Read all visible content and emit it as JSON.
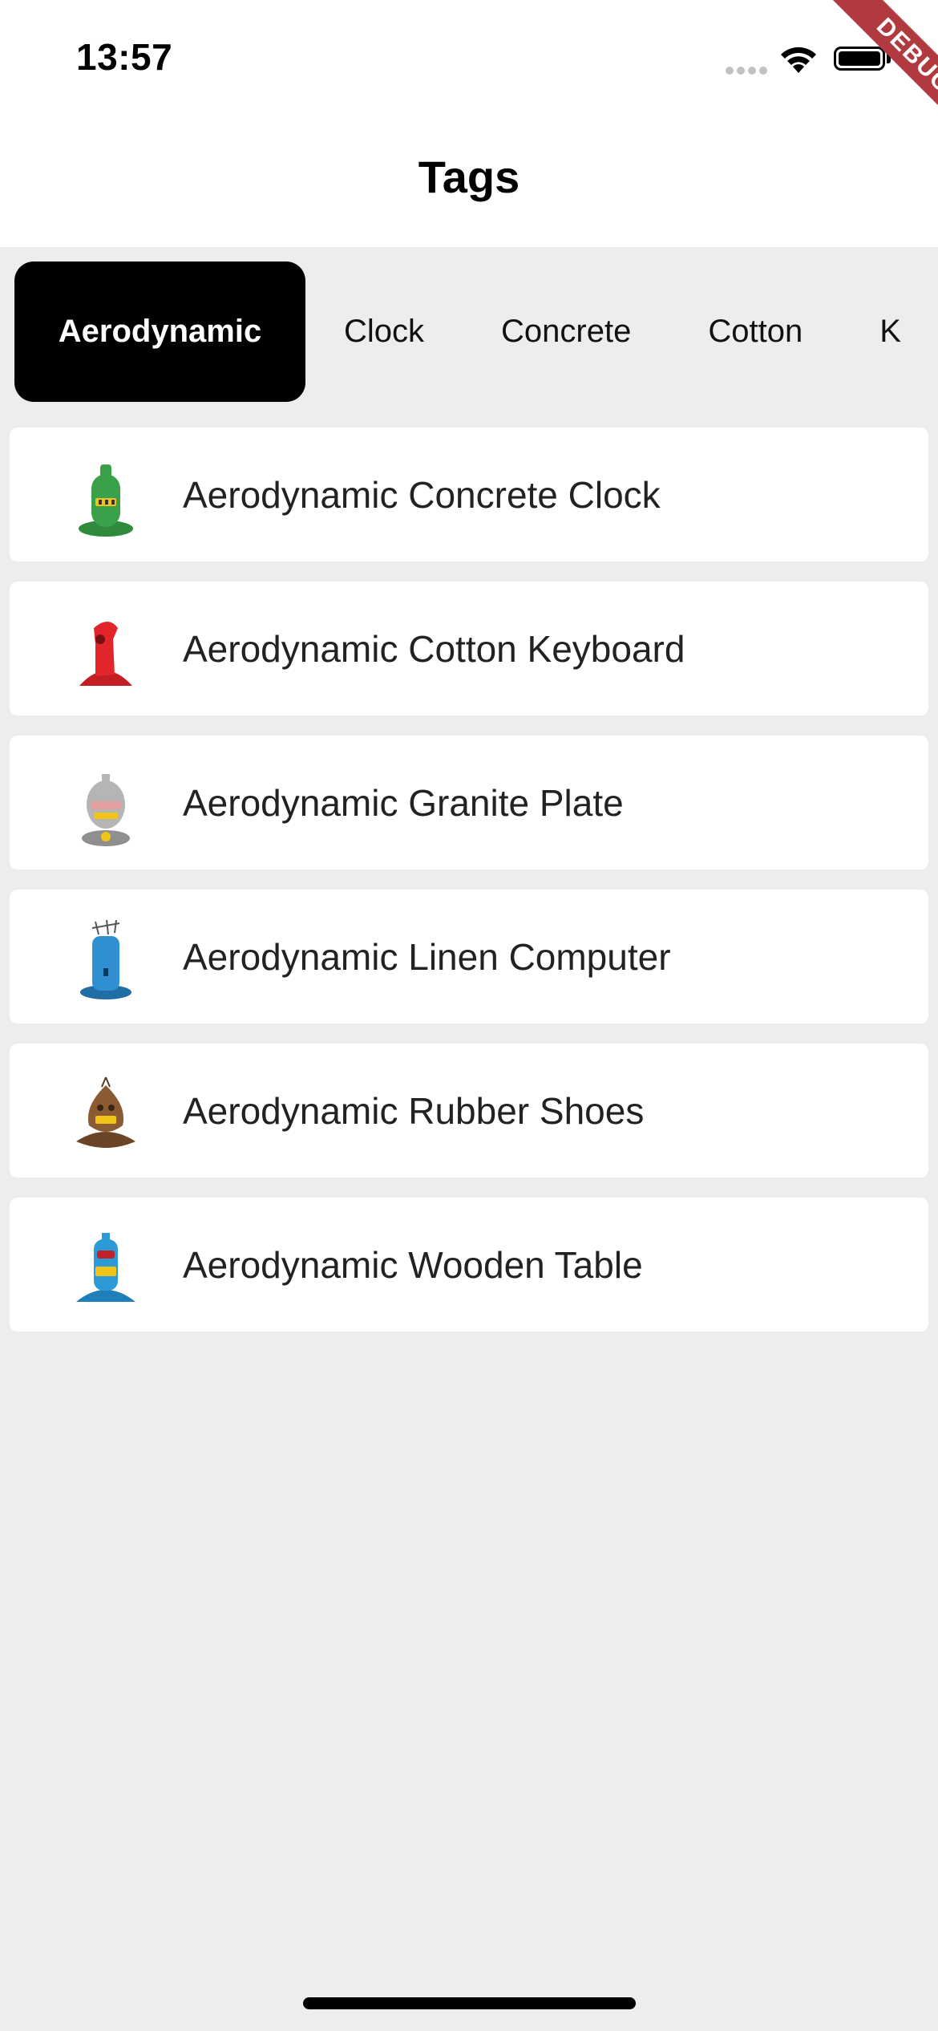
{
  "status_bar": {
    "time": "13:57",
    "signal_icon": "signal-dots-icon",
    "wifi_icon": "wifi-icon",
    "battery_icon": "battery-icon"
  },
  "debug_banner": {
    "text": "DEBUG",
    "color": "#b03a3f"
  },
  "app_bar": {
    "title": "Tags"
  },
  "tags": [
    {
      "label": "Aerodynamic",
      "selected": true
    },
    {
      "label": "Clock",
      "selected": false
    },
    {
      "label": "Concrete",
      "selected": false
    },
    {
      "label": "Cotton",
      "selected": false
    },
    {
      "label": "K",
      "selected": false
    }
  ],
  "products": [
    {
      "name": "Aerodynamic Concrete Clock",
      "icon": "green-robot-icon",
      "color": "#3aa14a"
    },
    {
      "name": "Aerodynamic Cotton Keyboard",
      "icon": "red-robot-icon",
      "color": "#e1262b"
    },
    {
      "name": "Aerodynamic Granite Plate",
      "icon": "gray-robot-icon",
      "color": "#a9a9a9"
    },
    {
      "name": "Aerodynamic Linen Computer",
      "icon": "blue-antenna-robot-icon",
      "color": "#2f8fd1"
    },
    {
      "name": "Aerodynamic Rubber Shoes",
      "icon": "brown-robot-icon",
      "color": "#7a5233"
    },
    {
      "name": "Aerodynamic Wooden Table",
      "icon": "blue-robot-icon",
      "color": "#2b9ad6"
    }
  ],
  "colors": {
    "background": "#ededed",
    "surface": "#ffffff",
    "selected_chip": "#000000"
  }
}
